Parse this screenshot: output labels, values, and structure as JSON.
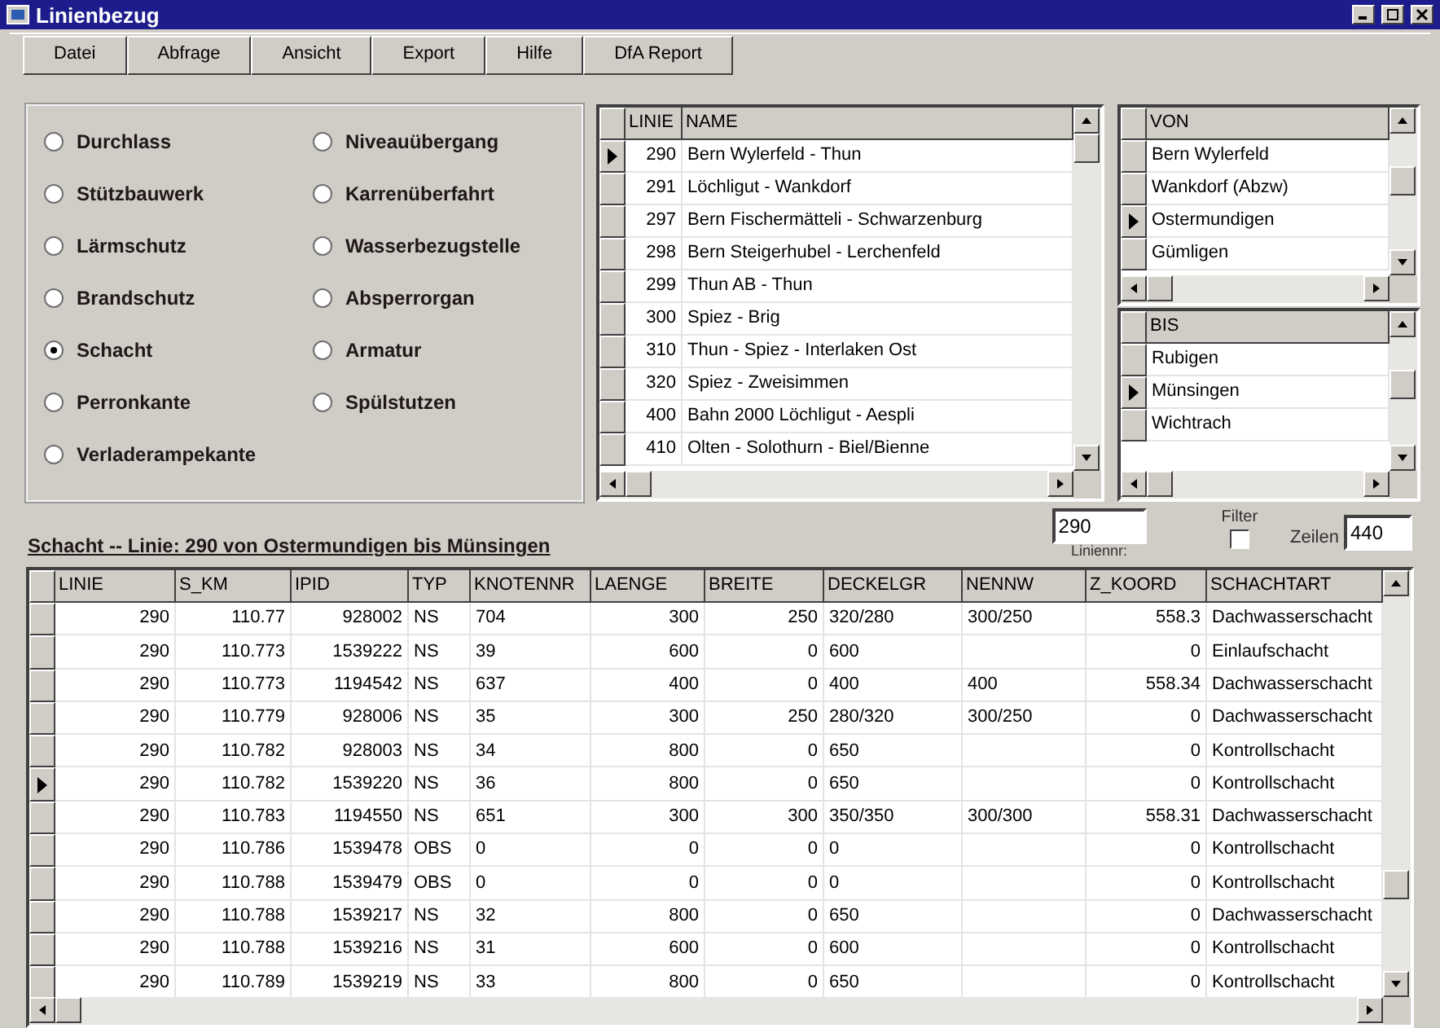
{
  "window": {
    "title": "Linienbezug"
  },
  "menu": [
    "Datei",
    "Abfrage",
    "Ansicht",
    "Export",
    "Hilfe",
    "DfA Report"
  ],
  "options": [
    {
      "label": "Durchlass",
      "selected": false
    },
    {
      "label": "Niveauübergang",
      "selected": false
    },
    {
      "label": "Stützbauwerk",
      "selected": false
    },
    {
      "label": "Karrenüberfahrt",
      "selected": false
    },
    {
      "label": "Lärmschutz",
      "selected": false
    },
    {
      "label": "Wasserbezugstelle",
      "selected": false
    },
    {
      "label": "Brandschutz",
      "selected": false
    },
    {
      "label": "Absperrorgan",
      "selected": false
    },
    {
      "label": "Schacht",
      "selected": true
    },
    {
      "label": "Armatur",
      "selected": false
    },
    {
      "label": "Perronkante",
      "selected": false
    },
    {
      "label": "Spülstutzen",
      "selected": false
    },
    {
      "label": "Verladerampekante",
      "selected": false
    }
  ],
  "lines_table": {
    "columns": [
      "LINIE",
      "NAME"
    ],
    "rows": [
      {
        "cells": [
          "290",
          "Bern Wylerfeld - Thun"
        ],
        "selected": true
      },
      {
        "cells": [
          "291",
          "Löchligut - Wankdorf"
        ],
        "selected": false
      },
      {
        "cells": [
          "297",
          "Bern Fischermätteli - Schwarzenburg"
        ],
        "selected": false
      },
      {
        "cells": [
          "298",
          "Bern Steigerhubel - Lerchenfeld"
        ],
        "selected": false
      },
      {
        "cells": [
          "299",
          "Thun AB - Thun"
        ],
        "selected": false
      },
      {
        "cells": [
          "300",
          "Spiez - Brig"
        ],
        "selected": false
      },
      {
        "cells": [
          "310",
          "Thun - Spiez - Interlaken Ost"
        ],
        "selected": false
      },
      {
        "cells": [
          "320",
          "Spiez - Zweisimmen"
        ],
        "selected": false
      },
      {
        "cells": [
          "400",
          "Bahn 2000 Löchligut - Aespli"
        ],
        "selected": false
      },
      {
        "cells": [
          "410",
          "Olten - Solothurn - Biel/Bienne"
        ],
        "selected": false
      }
    ]
  },
  "from_table": {
    "columns": [
      "VON"
    ],
    "rows": [
      {
        "cells": [
          "Bern Wylerfeld"
        ],
        "selected": false
      },
      {
        "cells": [
          "Wankdorf (Abzw)"
        ],
        "selected": false
      },
      {
        "cells": [
          "Ostermundigen"
        ],
        "selected": true
      },
      {
        "cells": [
          "Gümligen"
        ],
        "selected": false
      }
    ]
  },
  "to_table": {
    "columns": [
      "BIS"
    ],
    "rows": [
      {
        "cells": [
          "Rubigen"
        ],
        "selected": false
      },
      {
        "cells": [
          "Münsingen"
        ],
        "selected": true
      },
      {
        "cells": [
          "Wichtrach"
        ],
        "selected": false
      }
    ]
  },
  "heading": "Schacht -- Linie: 290 von Ostermundigen bis Münsingen",
  "line_number": {
    "value": "290",
    "label": "Liniennr:"
  },
  "filter": {
    "label": "Filter",
    "checked": false
  },
  "rows_count": {
    "label": "Zeilen",
    "value": "440"
  },
  "main_table": {
    "columns": [
      "LINIE",
      "S_KM",
      "IPID",
      "TYP",
      "KNOTENNR",
      "LAENGE",
      "BREITE",
      "DECKELGR",
      "NENNW",
      "Z_KOORD",
      "SCHACHTART"
    ],
    "rows": [
      {
        "cells": [
          "290",
          "110.77",
          "928002",
          "NS",
          "704",
          "300",
          "250",
          "320/280",
          "300/250",
          "558.3",
          "Dachwasserschacht"
        ],
        "selected": false
      },
      {
        "cells": [
          "290",
          "110.773",
          "1539222",
          "NS",
          "39",
          "600",
          "0",
          "600",
          "",
          "0",
          "Einlaufschacht"
        ],
        "selected": false
      },
      {
        "cells": [
          "290",
          "110.773",
          "1194542",
          "NS",
          "637",
          "400",
          "0",
          "400",
          "400",
          "558.34",
          "Dachwasserschacht"
        ],
        "selected": false
      },
      {
        "cells": [
          "290",
          "110.779",
          "928006",
          "NS",
          "35",
          "300",
          "250",
          "280/320",
          "300/250",
          "0",
          "Dachwasserschacht"
        ],
        "selected": false
      },
      {
        "cells": [
          "290",
          "110.782",
          "928003",
          "NS",
          "34",
          "800",
          "0",
          "650",
          "",
          "0",
          "Kontrollschacht"
        ],
        "selected": false
      },
      {
        "cells": [
          "290",
          "110.782",
          "1539220",
          "NS",
          "36",
          "800",
          "0",
          "650",
          "",
          "0",
          "Kontrollschacht"
        ],
        "selected": true
      },
      {
        "cells": [
          "290",
          "110.783",
          "1194550",
          "NS",
          "651",
          "300",
          "300",
          "350/350",
          "300/300",
          "558.31",
          "Dachwasserschacht"
        ],
        "selected": false
      },
      {
        "cells": [
          "290",
          "110.786",
          "1539478",
          "OBS",
          "0",
          "0",
          "0",
          "0",
          "",
          "0",
          "Kontrollschacht"
        ],
        "selected": false
      },
      {
        "cells": [
          "290",
          "110.788",
          "1539479",
          "OBS",
          "0",
          "0",
          "0",
          "0",
          "",
          "0",
          "Kontrollschacht"
        ],
        "selected": false
      },
      {
        "cells": [
          "290",
          "110.788",
          "1539217",
          "NS",
          "32",
          "800",
          "0",
          "650",
          "",
          "0",
          "Dachwasserschacht"
        ],
        "selected": false
      },
      {
        "cells": [
          "290",
          "110.788",
          "1539216",
          "NS",
          "31",
          "600",
          "0",
          "600",
          "",
          "0",
          "Kontrollschacht"
        ],
        "selected": false
      },
      {
        "cells": [
          "290",
          "110.789",
          "1539219",
          "NS",
          "33",
          "800",
          "0",
          "650",
          "",
          "0",
          "Kontrollschacht"
        ],
        "selected": false
      }
    ]
  }
}
